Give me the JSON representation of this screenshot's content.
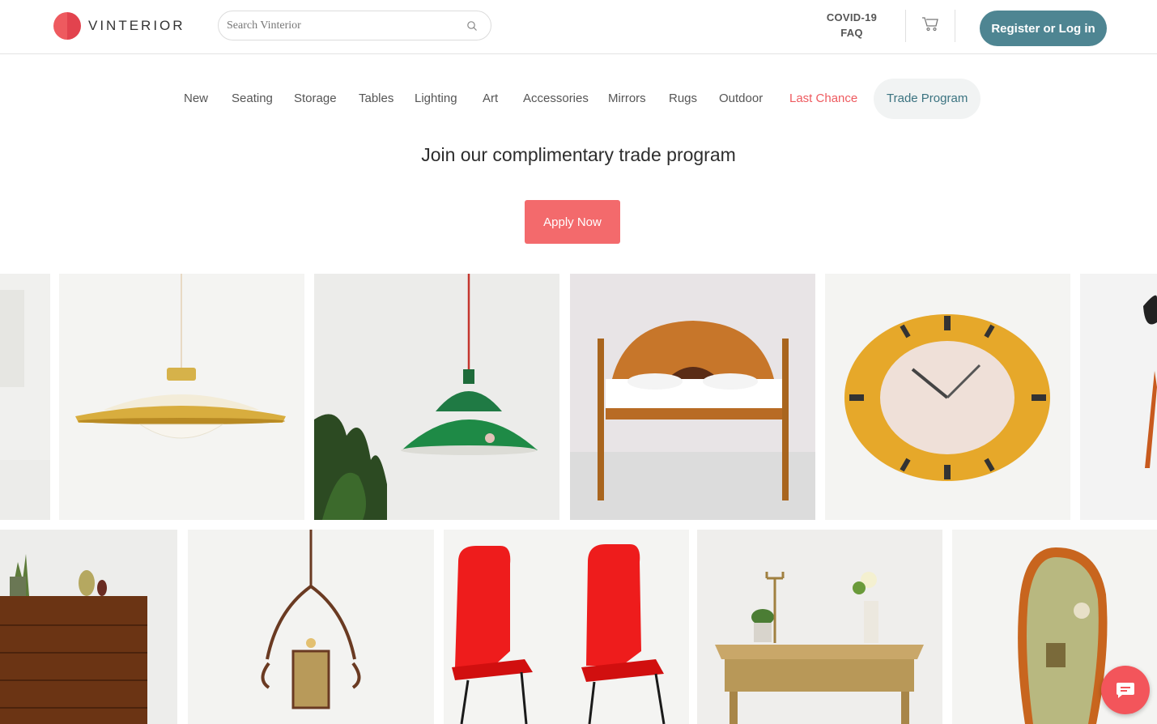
{
  "header": {
    "logo_text": "VINTERIOR",
    "search_placeholder": "Search Vinterior",
    "covid_line1": "COVID-19",
    "covid_line2": "FAQ",
    "login_label": "Register or Log in"
  },
  "nav": {
    "items": [
      "New",
      "Seating",
      "Storage",
      "Tables",
      "Lighting",
      "Art",
      "Accessories",
      "Mirrors",
      "Rugs",
      "Outdoor"
    ],
    "last_chance": "Last Chance",
    "trade": "Trade Program"
  },
  "hero": {
    "title": "Join our complimentary trade program",
    "cta": "Apply Now"
  },
  "colors": {
    "brand_red": "#ee5a5f",
    "teal": "#4e8592",
    "cta": "#f36a6c"
  },
  "icons": [
    "search-icon",
    "cart-icon",
    "chat-icon"
  ]
}
